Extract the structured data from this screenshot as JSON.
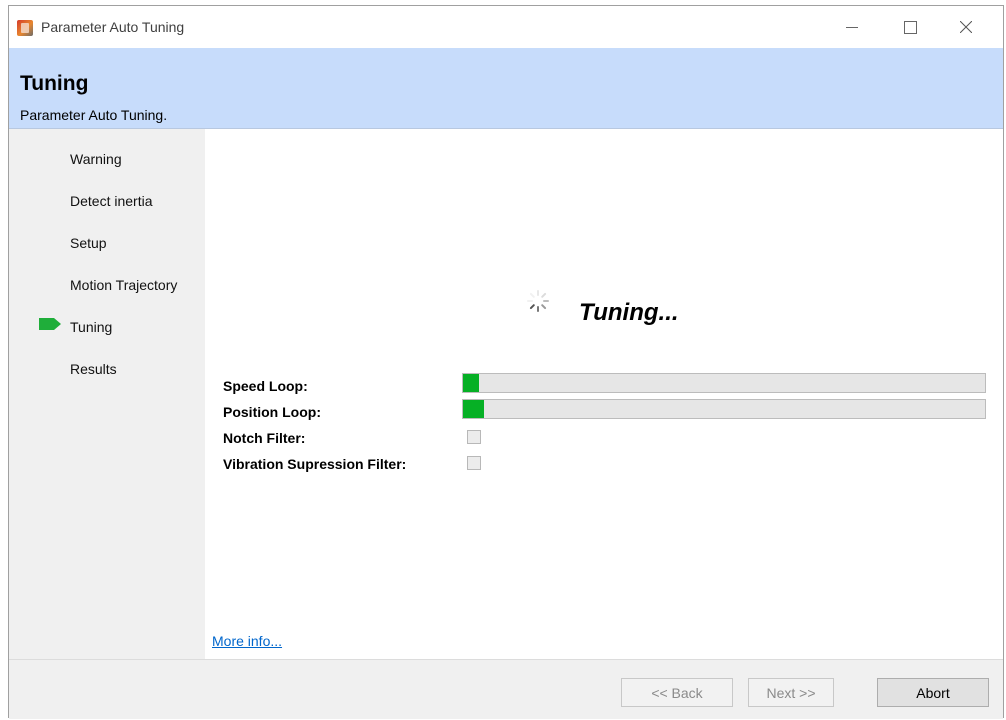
{
  "window": {
    "title": "Parameter Auto Tuning",
    "icon": "app-icon"
  },
  "header": {
    "title": "Tuning",
    "subtitle": "Parameter Auto Tuning."
  },
  "sidebar": {
    "items": [
      {
        "label": "Warning",
        "active": false
      },
      {
        "label": "Detect inertia",
        "active": false
      },
      {
        "label": "Setup",
        "active": false
      },
      {
        "label": "Motion Trajectory",
        "active": false
      },
      {
        "label": "Tuning",
        "active": true
      },
      {
        "label": "Results",
        "active": false
      }
    ],
    "active_marker_color": "#1fae3a"
  },
  "main": {
    "status_label": "Tuning...",
    "rows": [
      {
        "label": "Speed Loop:",
        "type": "progress",
        "progress": 0.03
      },
      {
        "label": "Position Loop:",
        "type": "progress",
        "progress": 0.04
      },
      {
        "label": "Notch Filter:",
        "type": "checkbox",
        "checked": false
      },
      {
        "label": "Vibration Supression Filter:",
        "type": "checkbox",
        "checked": false
      }
    ],
    "more_info": "More info..."
  },
  "footer": {
    "back_label": "<< Back",
    "next_label": "Next >>",
    "abort_label": "Abort"
  },
  "colors": {
    "header_bg": "#c7dcfb",
    "progress_fill": "#06b025",
    "link": "#0066cc"
  }
}
